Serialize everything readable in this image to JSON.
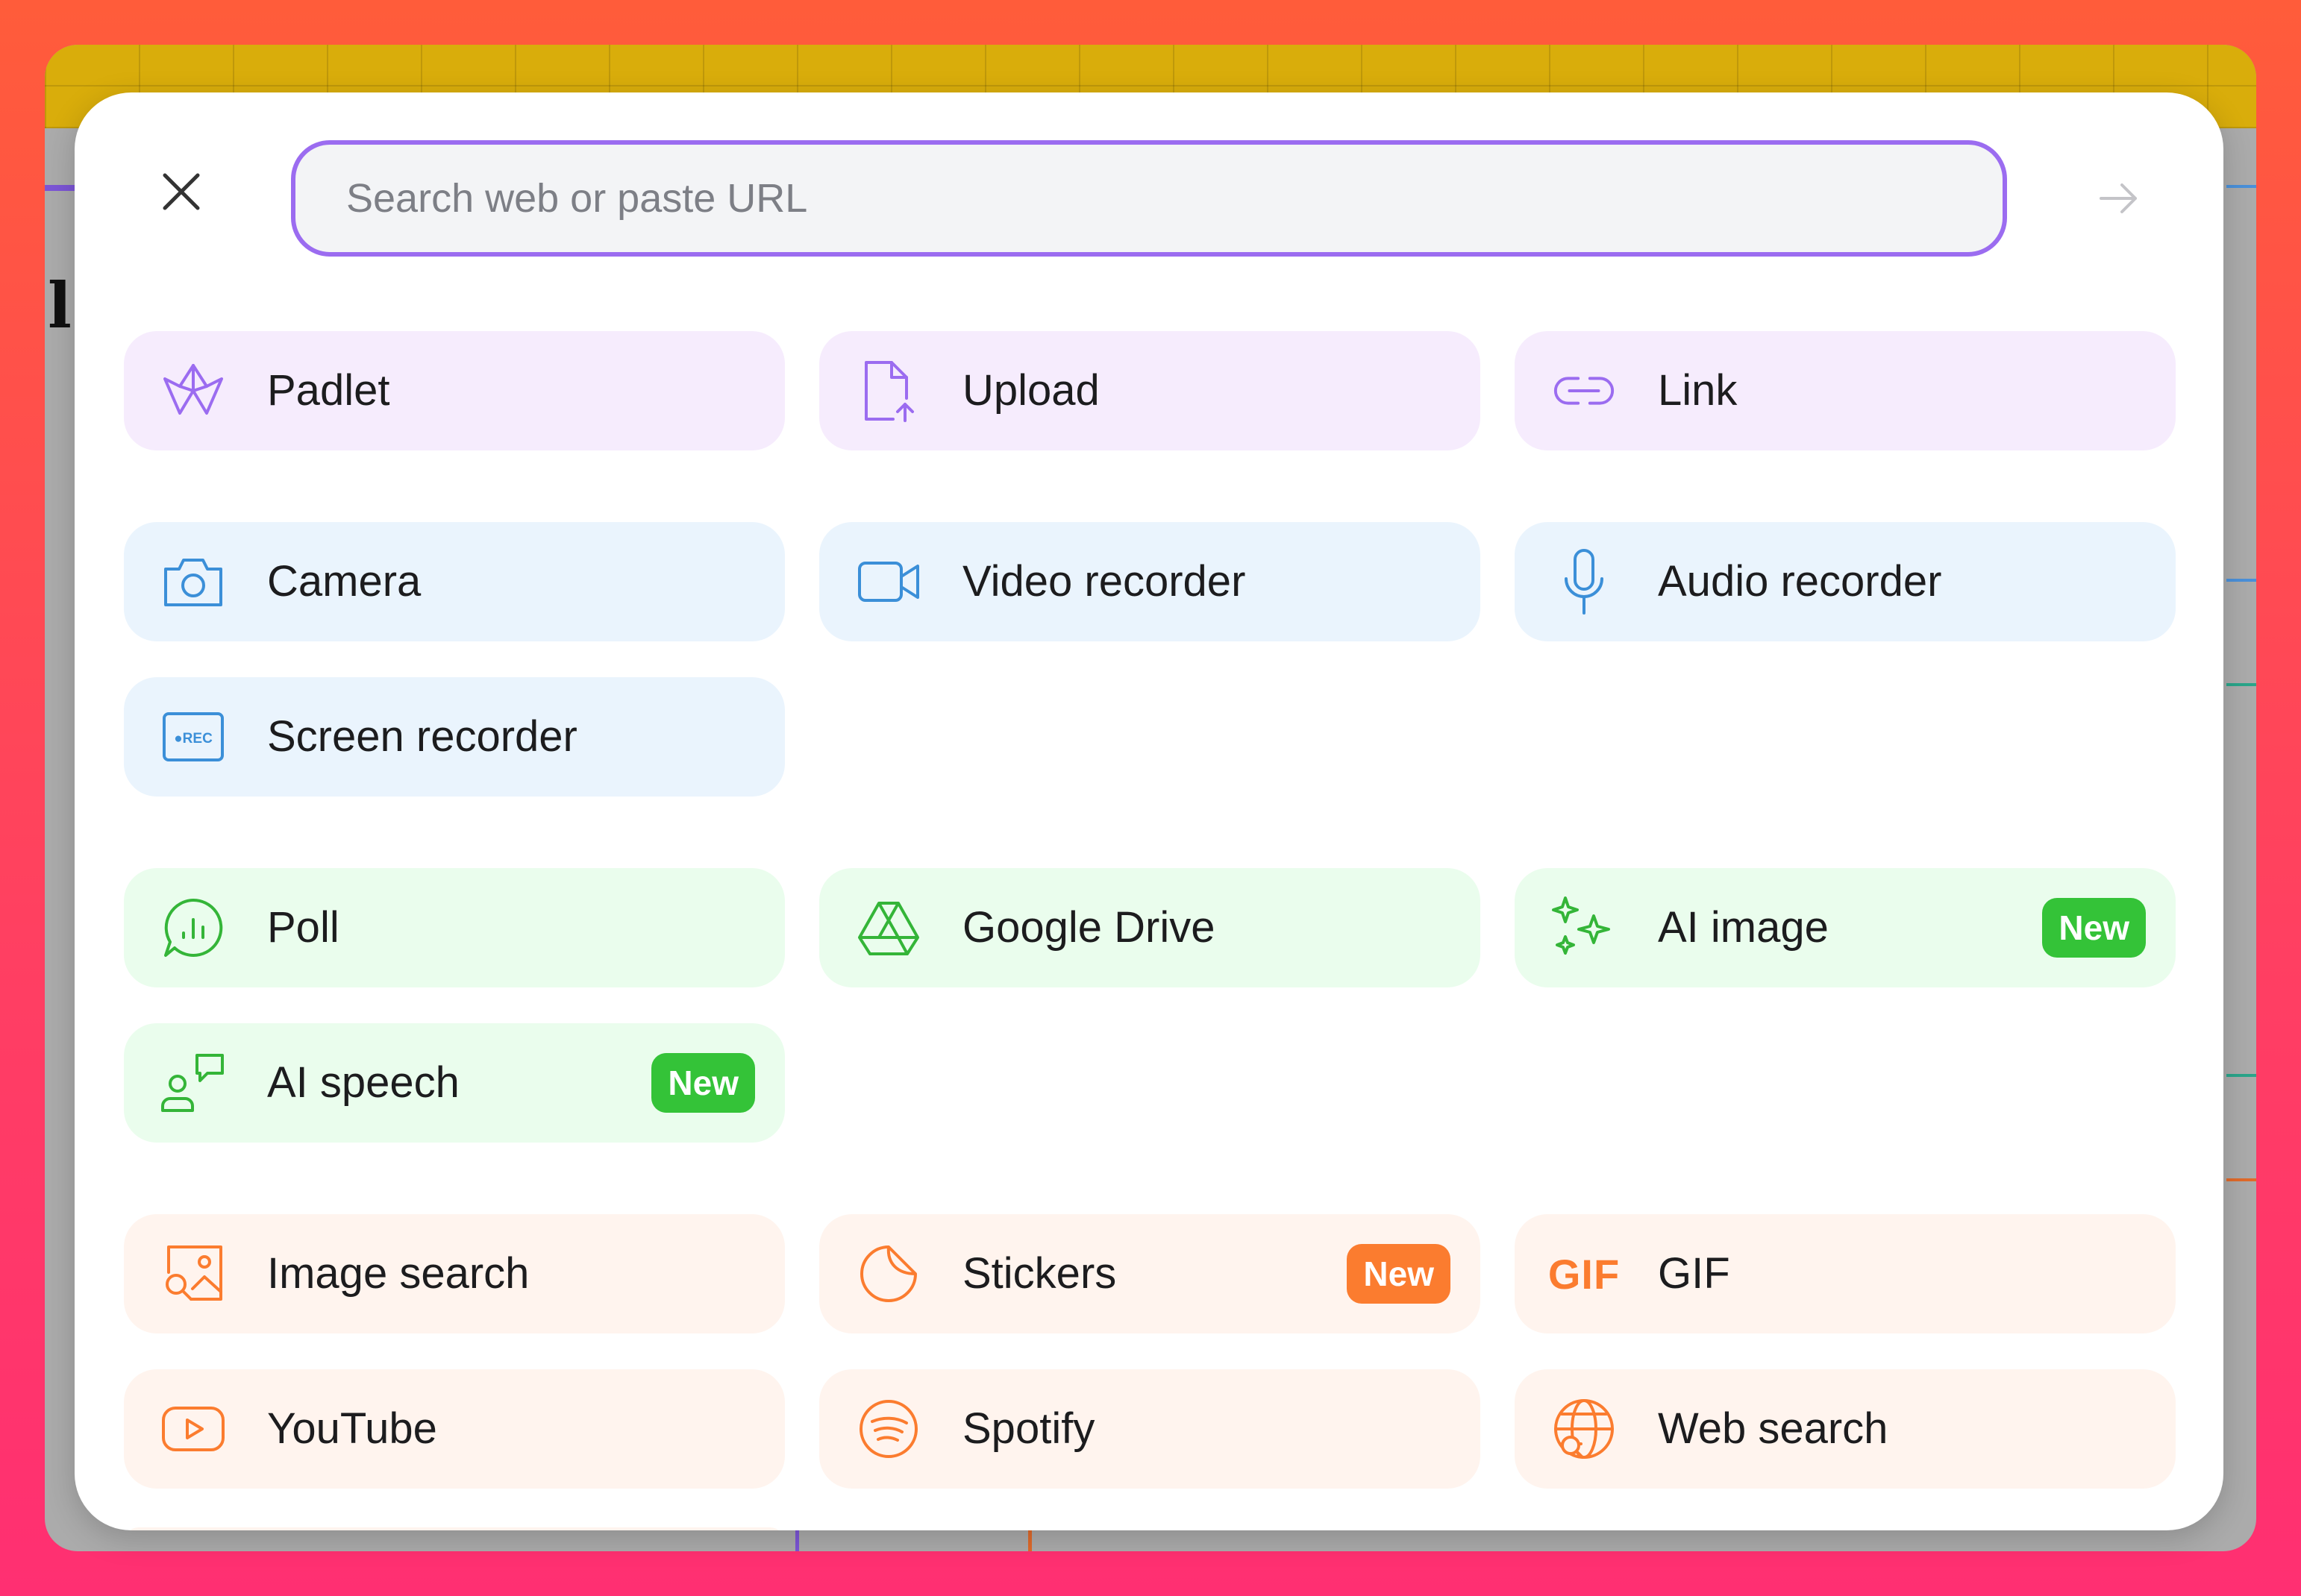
{
  "search": {
    "placeholder": "Search web or paste URL"
  },
  "icons": {
    "close": "close-icon",
    "submit": "arrow-right-icon"
  },
  "colors": {
    "accent": "#9b6cf0",
    "purple_group": "#f6ecfd",
    "blue_group": "#eaf4fd",
    "green_group": "#eafded",
    "orange_group": "#fff4ee",
    "badge_green": "#34c338",
    "badge_orange": "#fb7c2f"
  },
  "tiles": {
    "padlet": {
      "label": "Padlet",
      "icon": "padlet-crane-icon"
    },
    "upload": {
      "label": "Upload",
      "icon": "file-upload-icon"
    },
    "link": {
      "label": "Link",
      "icon": "link-icon"
    },
    "camera": {
      "label": "Camera",
      "icon": "camera-icon"
    },
    "video": {
      "label": "Video recorder",
      "icon": "video-camera-icon"
    },
    "audio": {
      "label": "Audio recorder",
      "icon": "microphone-icon"
    },
    "screen": {
      "label": "Screen recorder",
      "icon": "rec-screen-icon",
      "icon_text": "●REC"
    },
    "poll": {
      "label": "Poll",
      "icon": "poll-chat-icon"
    },
    "drive": {
      "label": "Google Drive",
      "icon": "google-drive-icon"
    },
    "aiimage": {
      "label": "AI image",
      "icon": "sparkles-icon",
      "badge": "New"
    },
    "aispeech": {
      "label": "AI speech",
      "icon": "speech-person-icon",
      "badge": "New"
    },
    "imagesearch": {
      "label": "Image search",
      "icon": "image-search-icon"
    },
    "stickers": {
      "label": "Stickers",
      "icon": "sticker-icon",
      "badge": "New"
    },
    "gif": {
      "label": "GIF",
      "icon": "gif-icon",
      "icon_text": "GIF"
    },
    "youtube": {
      "label": "YouTube",
      "icon": "youtube-play-icon"
    },
    "spotify": {
      "label": "Spotify",
      "icon": "spotify-icon"
    },
    "websearch": {
      "label": "Web search",
      "icon": "globe-search-icon"
    }
  }
}
